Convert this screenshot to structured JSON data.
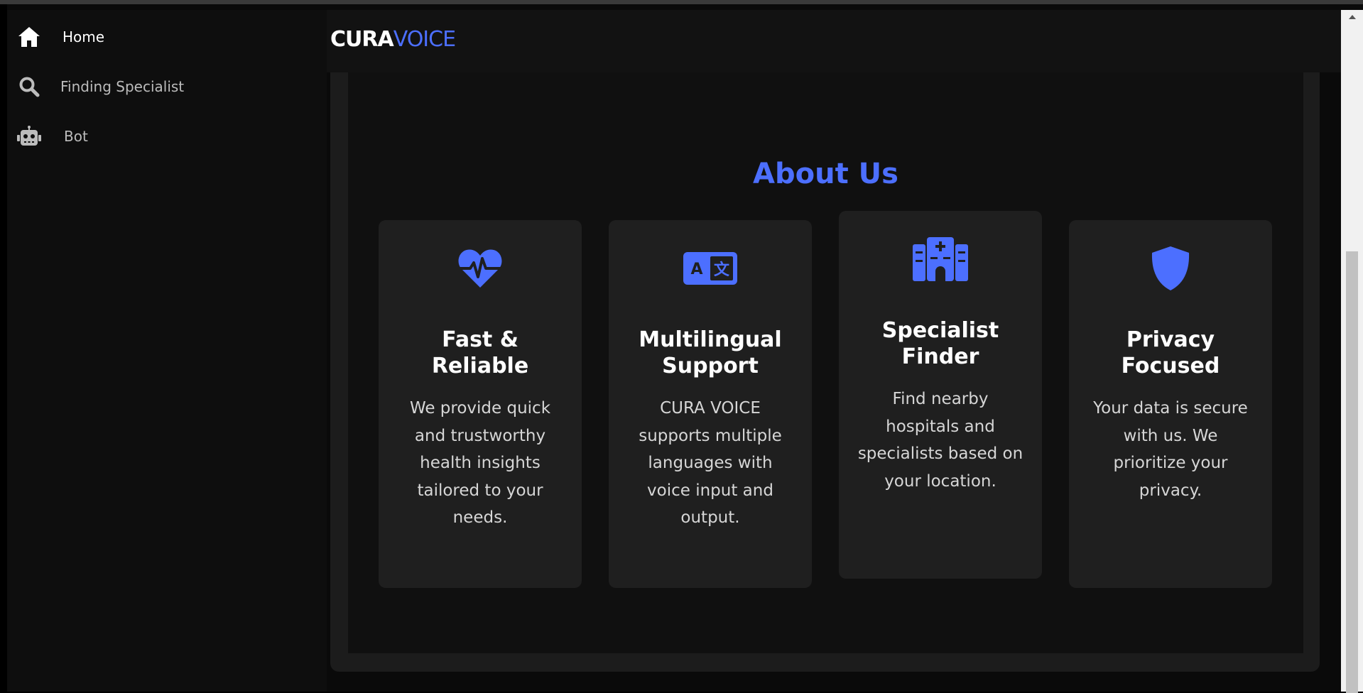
{
  "sidebar": {
    "items": [
      {
        "label": "Home",
        "icon": "home-icon",
        "active": true
      },
      {
        "label": "Finding Specialist",
        "icon": "search-icon",
        "active": false
      },
      {
        "label": "Bot",
        "icon": "robot-icon",
        "active": false
      }
    ]
  },
  "header": {
    "logo_part1": "CURA",
    "logo_part2": "VOICE"
  },
  "about": {
    "title": "About Us",
    "cards": [
      {
        "icon": "heart-pulse-icon",
        "title": "Fast & Reliable",
        "text": "We provide quick and trustworthy health insights tailored to your needs."
      },
      {
        "icon": "language-icon",
        "title": "Multilingual Support",
        "text": "CURA VOICE supports multiple languages with voice input and output."
      },
      {
        "icon": "hospital-icon",
        "title": "Specialist Finder",
        "text": "Find nearby hospitals and specialists based on your location."
      },
      {
        "icon": "shield-icon",
        "title": "Privacy Focused",
        "text": "Your data is secure with us. We prioritize your privacy."
      }
    ]
  },
  "colors": {
    "accent": "#4c6fff",
    "background": "#0a0a0a",
    "card": "#1f1f1f"
  }
}
